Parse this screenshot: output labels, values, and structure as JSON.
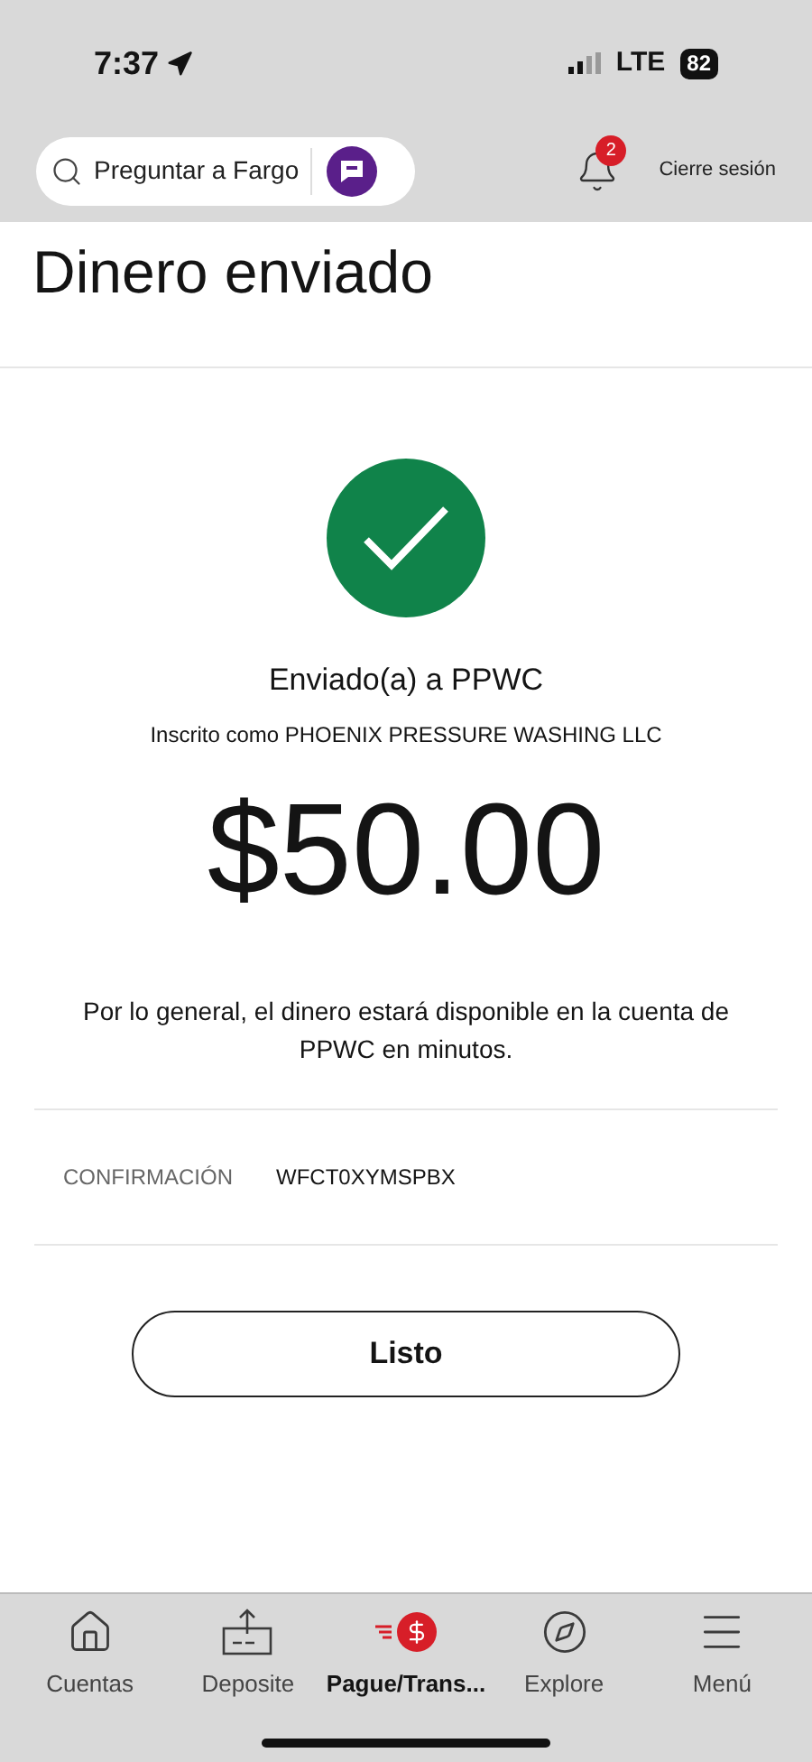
{
  "status_bar": {
    "time": "7:37",
    "network": "LTE",
    "battery": "82"
  },
  "header": {
    "search": {
      "placeholder": "Preguntar a Fargo"
    },
    "notifications": {
      "count": "2"
    },
    "logout": "Cierre sesión"
  },
  "title": "Dinero enviado",
  "confirmation": {
    "recipient": "Enviado(a) a PPWC",
    "enrolled_as": "Inscrito como PHOENIX PRESSURE WASHING LLC",
    "amount": "$50.00",
    "note": "Por lo general, el dinero estará disponible en la cuenta de PPWC en minutos.",
    "confirmation_label": "CONFIRMACIÓN",
    "confirmation_number": "WFCT0XYMSPBX",
    "done_button": "Listo"
  },
  "bottom_nav": [
    {
      "kind": "home",
      "label": "Cuentas",
      "selected": false
    },
    {
      "kind": "deposit",
      "label": "Deposite",
      "selected": false
    },
    {
      "kind": "pay",
      "label": "Pague/Trans...",
      "selected": true
    },
    {
      "kind": "explore",
      "label": "Explore",
      "selected": false
    },
    {
      "kind": "menu",
      "label": "Menú",
      "selected": false
    }
  ]
}
